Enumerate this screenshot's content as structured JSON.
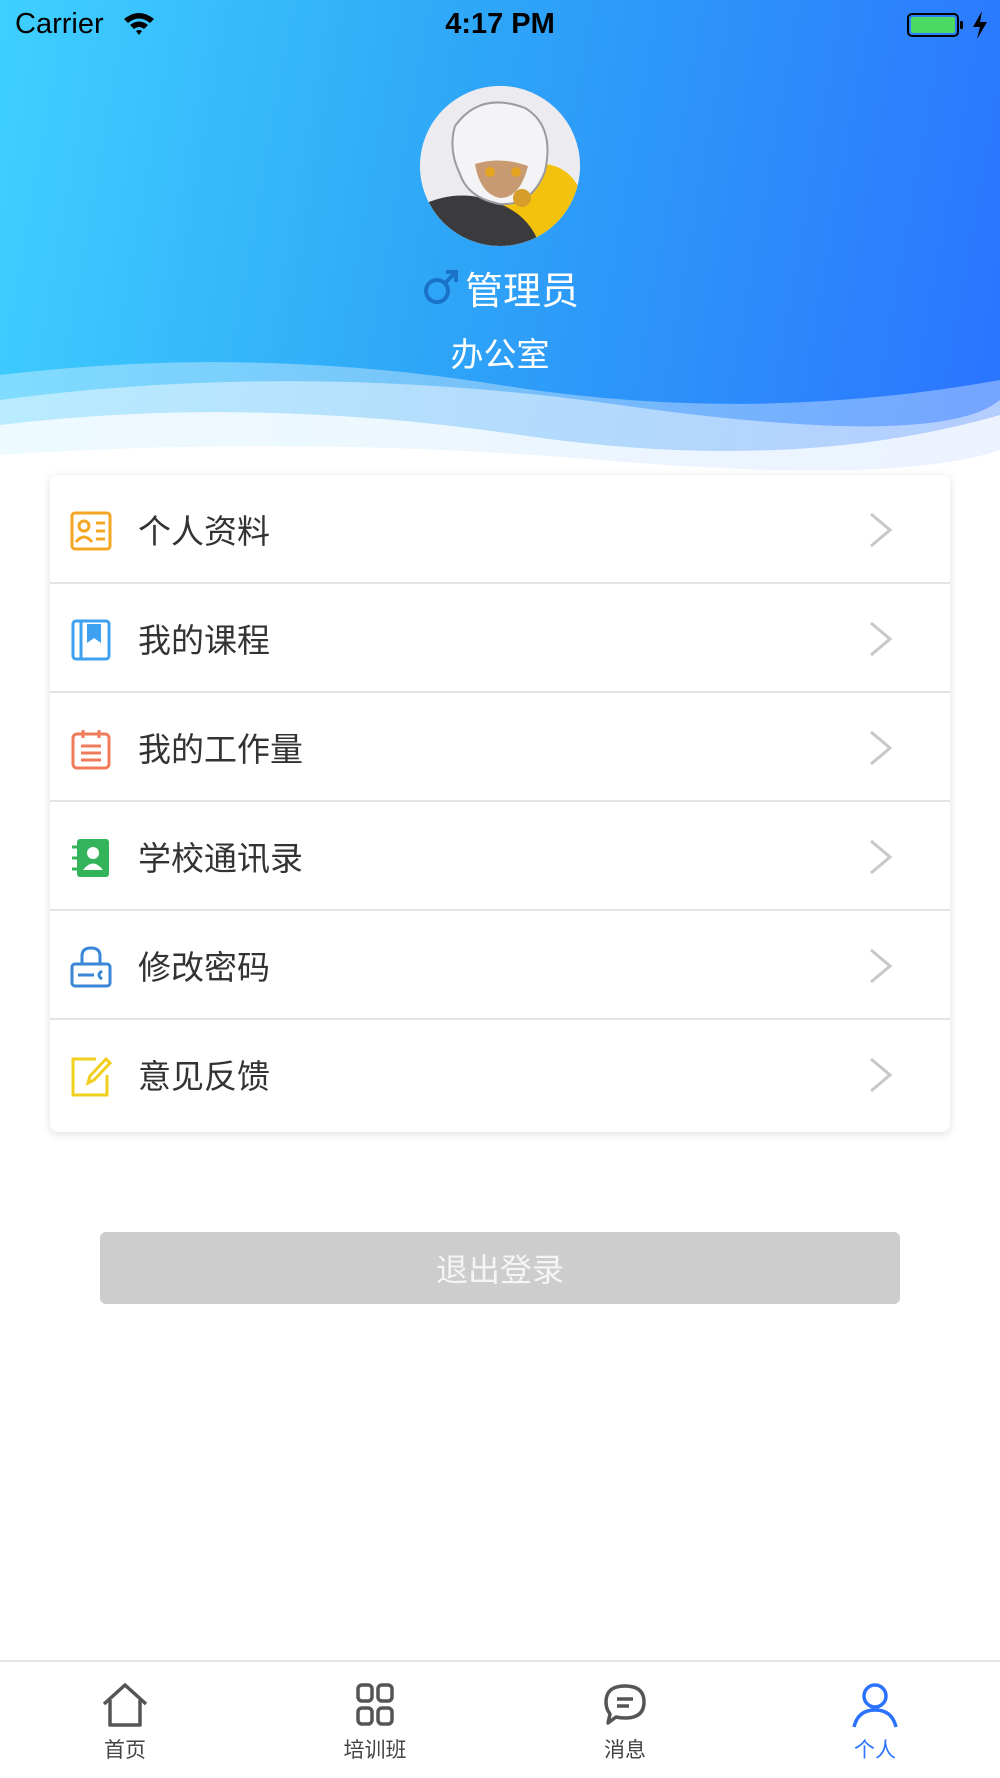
{
  "status_bar": {
    "carrier": "Carrier",
    "time": "4:17 PM",
    "battery_color": "#4cd964"
  },
  "profile": {
    "gender_icon": "male-symbol-icon",
    "name": "管理员",
    "department": "办公室"
  },
  "menu": {
    "items": [
      {
        "label": "个人资料",
        "icon": "profile-card-icon",
        "color": "#f5a623"
      },
      {
        "label": "我的课程",
        "icon": "book-icon",
        "color": "#3ea0f0"
      },
      {
        "label": "我的工作量",
        "icon": "calendar-list-icon",
        "color": "#f07b5a"
      },
      {
        "label": "学校通讯录",
        "icon": "contacts-icon",
        "color": "#34b45a"
      },
      {
        "label": "修改密码",
        "icon": "lock-icon",
        "color": "#3a86d6"
      },
      {
        "label": "意见反馈",
        "icon": "edit-icon",
        "color": "#f2cf1f"
      }
    ]
  },
  "logout_label": "退出登录",
  "tab_bar": {
    "active_color": "#2b73ff",
    "tabs": [
      {
        "label": "首页",
        "icon": "home-icon"
      },
      {
        "label": "培训班",
        "icon": "grid-icon"
      },
      {
        "label": "消息",
        "icon": "message-icon"
      },
      {
        "label": "个人",
        "icon": "person-icon",
        "active": true
      }
    ]
  }
}
